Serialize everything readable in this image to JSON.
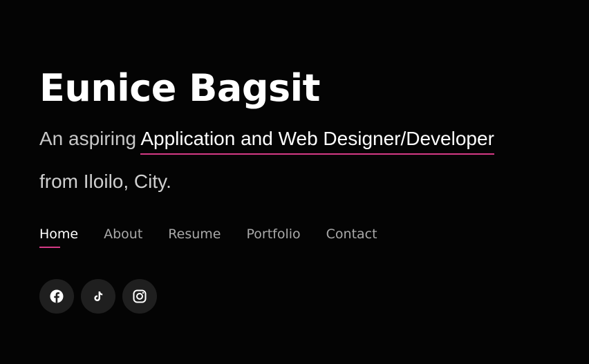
{
  "hero": {
    "name": "Eunice Bagsit",
    "tagline_lead": "An aspiring ",
    "tagline_highlight": "Application and Web Designer/Developer",
    "tagline_place": "from Iloilo, City."
  },
  "nav": {
    "items": [
      {
        "label": "Home",
        "active": true
      },
      {
        "label": "About",
        "active": false
      },
      {
        "label": "Resume",
        "active": false
      },
      {
        "label": "Portfolio",
        "active": false
      },
      {
        "label": "Contact",
        "active": false
      }
    ]
  },
  "social": {
    "icons": [
      "facebook-icon",
      "tiktok-icon",
      "instagram-icon"
    ]
  },
  "colors": {
    "background": "#040404",
    "accent": "#d63a86",
    "nav_inactive": "#a9a9a9",
    "social_button_bg": "#1f1f1f"
  }
}
